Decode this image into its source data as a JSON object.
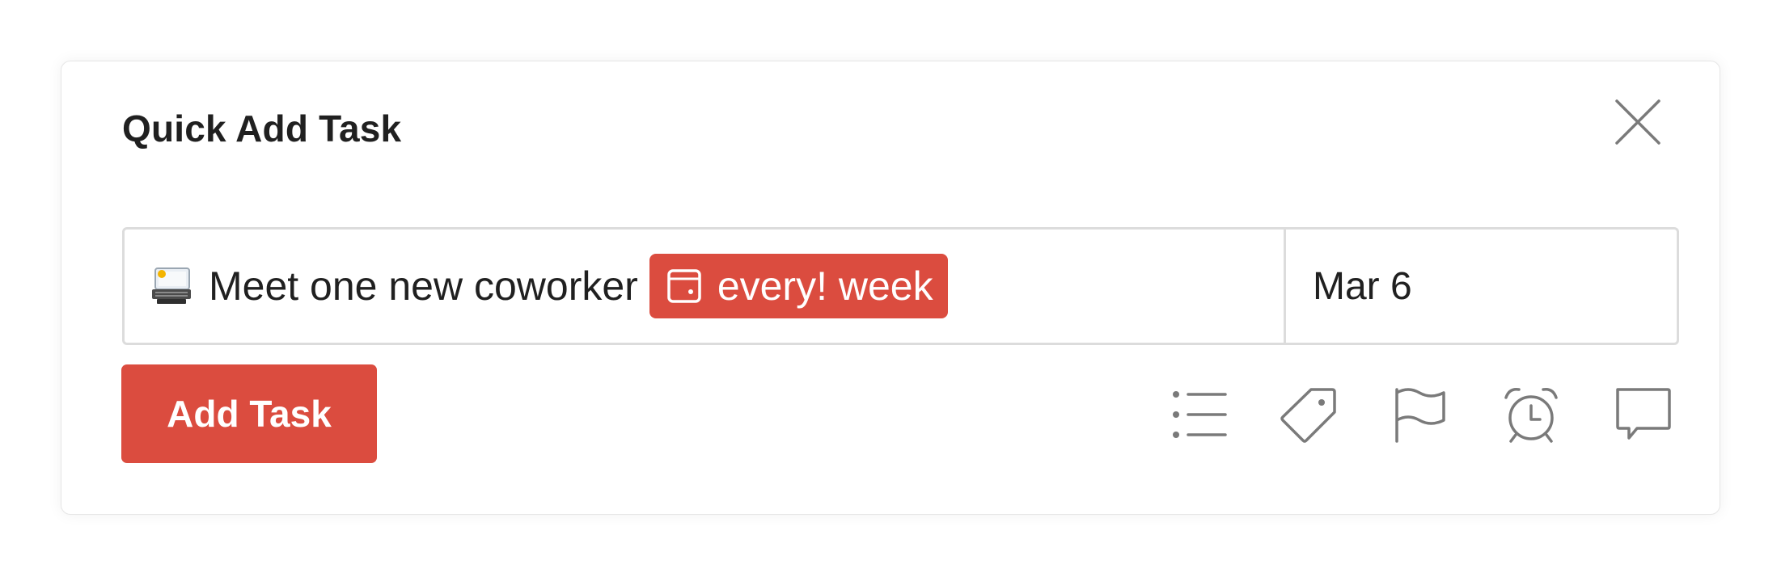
{
  "dialog": {
    "title": "Quick Add Task",
    "close_icon": "close-icon"
  },
  "task": {
    "emoji": "desktop-computer-emoji",
    "text": "Meet one new coworker",
    "recurrence_label": "every! week",
    "recurrence_icon": "calendar-icon",
    "date": "Mar 6"
  },
  "actions": {
    "add_task_label": "Add Task"
  },
  "toolbar": {
    "icons": [
      "list-icon",
      "tag-icon",
      "flag-icon",
      "alarm-clock-icon",
      "comment-icon"
    ]
  },
  "colors": {
    "accent": "#db4c3f",
    "text": "#202020",
    "icon": "#808080",
    "border": "#dcdcdc"
  }
}
